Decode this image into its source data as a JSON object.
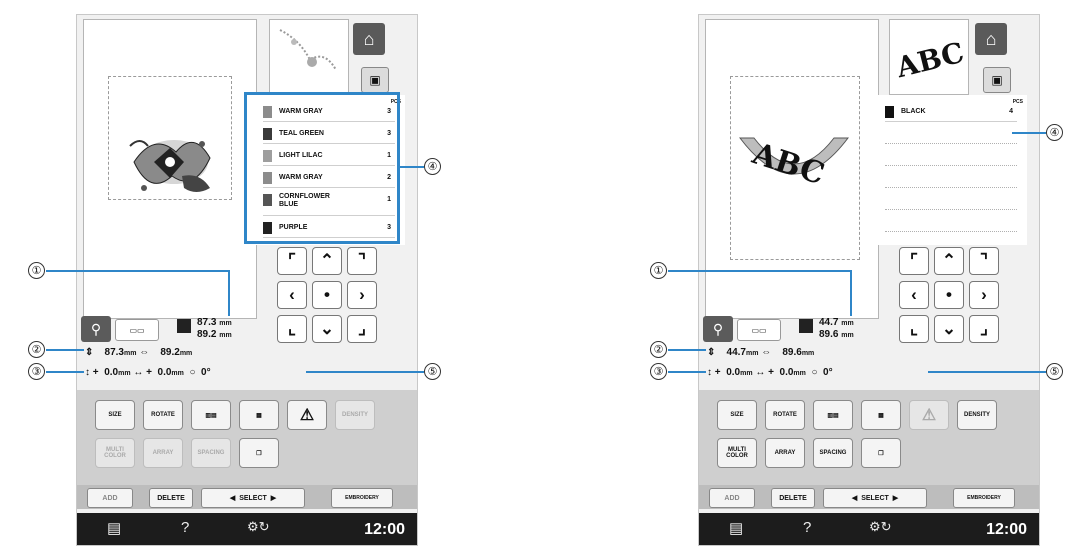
{
  "left": {
    "threads": [
      {
        "name": "WARM GRAY",
        "count": "3",
        "color": "#8c8c8c"
      },
      {
        "name": "TEAL GREEN",
        "count": "3",
        "color": "#3a3a3a"
      },
      {
        "name": "LIGHT LILAC",
        "count": "1",
        "color": "#9e9e9e"
      },
      {
        "name": "WARM GRAY",
        "count": "2",
        "color": "#8c8c8c"
      },
      {
        "name": "CORNFLOWER BLUE",
        "count": "1",
        "color": "#555555"
      },
      {
        "name": "PURPLE",
        "count": "3",
        "color": "#222222"
      }
    ],
    "pcs_label": "PCS",
    "width_mm": "87.3",
    "height_mm": "89.2",
    "size_w": "87.3",
    "size_h": "89.2",
    "pos_v": "0.0",
    "pos_h": "0.0",
    "angle": "0°",
    "unit": "mm",
    "buttons": [
      "SIZE",
      "ROTATE",
      "",
      "",
      "",
      "DENSITY",
      "MULTI COLOR",
      "ARRAY",
      "SPACING",
      ""
    ]
  },
  "right": {
    "threads": [
      {
        "name": "BLACK",
        "count": "4",
        "color": "#111111"
      }
    ],
    "pcs_label": "PCS",
    "thumb_text": "ABC",
    "design_text": "ABC",
    "width_mm": "44.7",
    "height_mm": "89.6",
    "size_w": "44.7",
    "size_h": "89.6",
    "pos_v": "0.0",
    "pos_h": "0.0",
    "angle": "0°",
    "unit": "mm",
    "buttons": [
      "SIZE",
      "ROTATE",
      "",
      "",
      "",
      "DENSITY",
      "MULTI COLOR",
      "ARRAY",
      "SPACING",
      ""
    ]
  },
  "common": {
    "add_label": "ADD",
    "delete_label": "DELETE",
    "select_label": "SELECT",
    "embroidery_label": "EMBROIDERY",
    "clock": "12:00",
    "help_glyph": "?",
    "plus": "+"
  },
  "callouts": [
    "①",
    "②",
    "③",
    "④",
    "⑤"
  ],
  "colors": {
    "callout_line": "#2f86c8",
    "highlight_box": "#2f86c8"
  }
}
